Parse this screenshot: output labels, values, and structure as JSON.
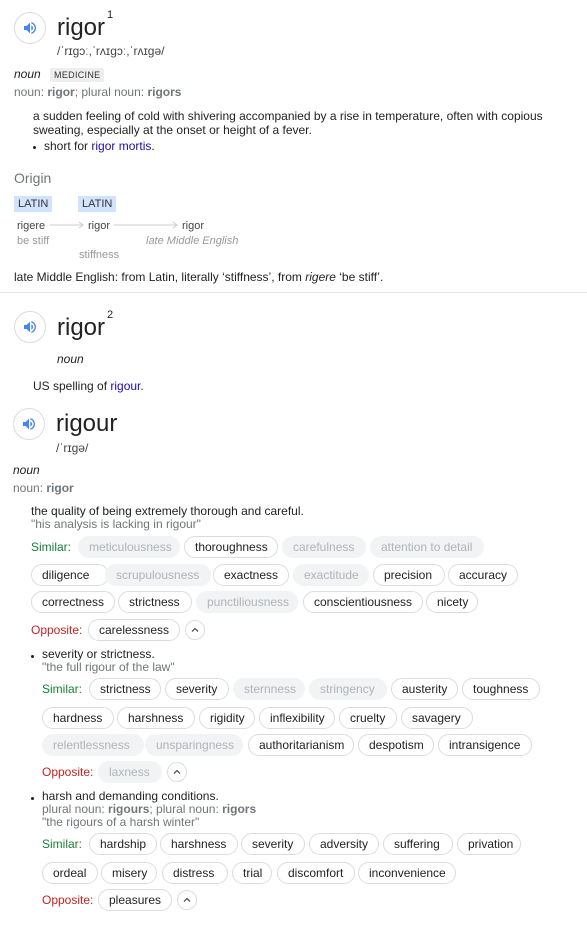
{
  "entry1": {
    "word": "rigor",
    "superscript": "1",
    "pronunciation": "/ˈrɪɡɔː,ˈrʌɪɡɔː,ˈrʌɪɡə/",
    "pos": "noun",
    "tag": "MEDICINE",
    "forms_prefix": "noun: ",
    "forms_main": "rigor",
    "forms_mid": "; plural noun: ",
    "forms_plural": "rigors",
    "definition": "a sudden feeling of cold with shivering accompanied by a rise in temperature, often with copious sweating, especially at the onset or height of a fever.",
    "sub_prefix": "short for ",
    "sub_link": "rigor mortis",
    "sub_suffix": "."
  },
  "origin": {
    "title": "Origin",
    "lang1": "LATIN",
    "lang2": "LATIN",
    "word1": "rigere",
    "gloss1": "be stiff",
    "word2": "rigor",
    "gloss2": "stiffness",
    "word3": "rigor",
    "gloss3": "late Middle English",
    "text_a": "late Middle English: from Latin, literally ‘stiffness’, from ",
    "text_it": "rigere",
    "text_b": " ‘be stiff’."
  },
  "entry2": {
    "word": "rigor",
    "superscript": "2",
    "pos": "noun",
    "def_prefix": "US spelling of ",
    "def_link": "rigour",
    "def_suffix": "."
  },
  "entry3": {
    "word": "rigour",
    "pronunciation": "/ˈrɪɡə/",
    "pos": "noun",
    "forms_prefix": "noun: ",
    "forms_main": "rigor",
    "sense1": {
      "definition": "the quality of being extremely thorough and careful.",
      "example": "\"his analysis is lacking in rigour\"",
      "similar_label": "Similar:",
      "similar": [
        "meticulousness",
        "thoroughness",
        "carefulness",
        "attention to detail",
        "diligence",
        "scrupulousness",
        "exactness",
        "exactitude",
        "precision",
        "accuracy",
        "correctness",
        "strictness",
        "punctiliousness",
        "conscientiousness",
        "nicety"
      ],
      "opposite_label": "Opposite:",
      "opposite": [
        "carelessness"
      ]
    },
    "sense2": {
      "definition": "severity or strictness.",
      "example": "\"the full rigour of the law\"",
      "similar_label": "Similar:",
      "similar": [
        "strictness",
        "severity",
        "sternness",
        "stringency",
        "austerity",
        "toughness",
        "hardness",
        "harshness",
        "rigidity",
        "inflexibility",
        "cruelty",
        "savagery",
        "relentlessness",
        "unsparingness",
        "authoritarianism",
        "despotism",
        "intransigence"
      ],
      "opposite_label": "Opposite:",
      "opposite": [
        "laxness"
      ]
    },
    "sense3": {
      "definition": "harsh and demanding conditions.",
      "forms_a": "plural noun: ",
      "forms_b": "rigours",
      "forms_c": "; plural noun: ",
      "forms_d": "rigors",
      "example": "\"the rigours of a harsh winter\"",
      "similar_label": "Similar:",
      "similar": [
        "hardship",
        "harshness",
        "severity",
        "adversity",
        "suffering",
        "privation",
        "ordeal",
        "misery",
        "distress",
        "trial",
        "discomfort",
        "inconvenience"
      ],
      "opposite_label": "Opposite:",
      "opposite": [
        "pleasures"
      ]
    }
  }
}
